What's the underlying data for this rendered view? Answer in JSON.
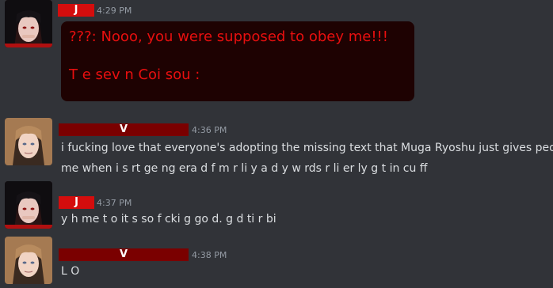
{
  "messages": [
    {
      "author_badge": "J",
      "author_color": "#d40d0d",
      "timestamp": "4:29 PM",
      "embed": {
        "line1": "???: Nooo, you were supposed to obey me!!!",
        "line2": "T e sev n Coi  sou  :"
      }
    },
    {
      "author_badge": "V",
      "author_color": "#7a0000",
      "timestamp": "4:36 PM",
      "lines": [
        "i fucking love that everyone's adopting the missing text that Muga Ryoshu just gives people",
        "me when i s  rt ge   ng era  d f  m r  li y a d  y w rds  r  li er  ly g t in  cu   ff"
      ]
    },
    {
      "author_badge": "J",
      "author_color": "#d40d0d",
      "timestamp": "4:37 PM",
      "lines": [
        "y  h me t  o it s so f cki  g go d. g d ti r bi"
      ]
    },
    {
      "author_badge": "V",
      "author_color": "#7a0000",
      "timestamp": "4:38 PM",
      "lines": [
        "L  O"
      ]
    }
  ]
}
